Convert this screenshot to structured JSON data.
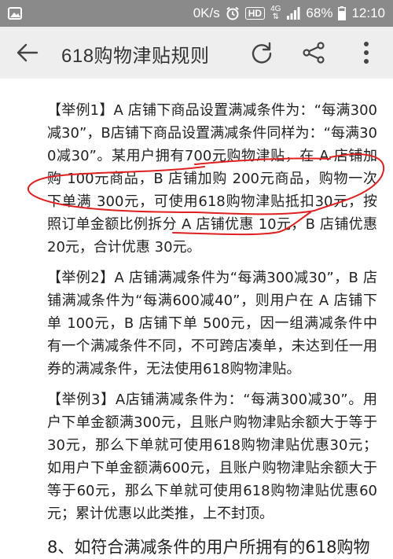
{
  "status_bar": {
    "network_speed": "0K/s",
    "hd_label": "HD",
    "network_type": "4G",
    "battery": "68%",
    "time": "12:10"
  },
  "app_bar": {
    "title": "618购物津贴规则"
  },
  "content": {
    "paragraphs": [
      "【举例1】A 店铺下商品设置满减条件为：“每满300减30”，B店铺下商品设置满减条件同样为：“每满300减30”。某用户拥有700元购物津贴，在 A 店铺加购 100元商品，B 店铺加购 200元商品，购物一次下单满 300元，可使用618购物津贴抵扣30元，按照订单金额比例拆分 A 店铺优惠 10元，B 店铺优惠 20元，合计优惠 30元。",
      "【举例2】A 店铺满减条件为“每满300减30”，B 店铺满减条件为“每满600减40”，则用户在 A 店铺下单 100元，B 店铺下单 500元，因一组满减条件中有一个满减条件不同，不可跨店凑单，未达到任一用券的满减条件，无法使用618购物津贴。",
      "【举例3】A店铺满减条件为：“每满300减30”。用户下单金额满300元，且账户购物津贴余额大于等于30元，那么下单就可使用618购物津贴优惠30元；如用户下单金额满600元，且账户购物津贴余额大于等于60元，那么下单就可使用618购物津贴优惠60元；累计优惠以此类推，上不封顶。"
    ],
    "section_heading": "8、如符合满减条件的用户所拥有的618购物"
  },
  "colors": {
    "status_bar_bg": "#8a8a8a",
    "app_bar_bg": "#eeeeee",
    "annotation_red": "#e02020"
  },
  "icons": {
    "back": "arrow-left-icon",
    "refresh": "refresh-icon",
    "share": "share-icon",
    "more": "more-vertical-icon"
  }
}
